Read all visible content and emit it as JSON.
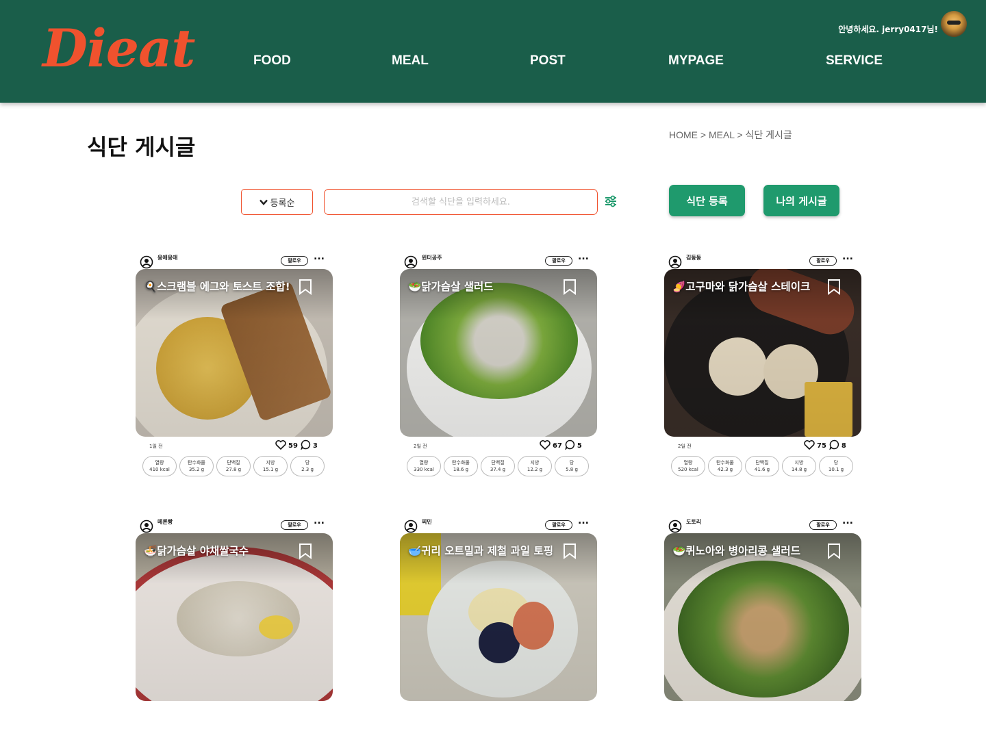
{
  "header": {
    "logo": "Dieat",
    "nav": [
      "FOOD",
      "MEAL",
      "POST",
      "MYPAGE",
      "SERVICE"
    ],
    "greeting": "안녕하세요. jerry0417님!"
  },
  "page": {
    "title": "식단 게시글",
    "breadcrumb": "HOME > MEAL > 식단 게시글"
  },
  "toolbar": {
    "sort_label": "등록순",
    "search_placeholder": "검색할 식단을 입력하세요.",
    "register_label": "식단 등록",
    "my_posts_label": "나의 게시글"
  },
  "nutrient_labels": [
    "열량",
    "탄수화물",
    "단백질",
    "지방",
    "당"
  ],
  "follow_label": "팔로우",
  "more_label": "...",
  "posts": [
    {
      "user": "응애응애",
      "title": "🍳스크램블 에그와 토스트 조합!",
      "time": "1일 전",
      "likes": "59",
      "comments": "3",
      "nutrients": [
        "410 kcal",
        "35.2 g",
        "27.8 g",
        "15.1 g",
        "2.3 g"
      ]
    },
    {
      "user": "윈터공주",
      "title": "🥗닭가슴살 샐러드",
      "time": "2일 전",
      "likes": "67",
      "comments": "5",
      "nutrients": [
        "330 kcal",
        "18.6 g",
        "37.4 g",
        "12.2 g",
        "5.8 g"
      ]
    },
    {
      "user": "김동동",
      "title": "🍠고구마와 닭가슴살 스테이크",
      "time": "2일 전",
      "likes": "75",
      "comments": "8",
      "nutrients": [
        "520 kcal",
        "42.3 g",
        "41.6 g",
        "14.8 g",
        "10.1 g"
      ]
    },
    {
      "user": "메론빵",
      "title": "🍜닭가슴살 야채쌀국수",
      "time": "",
      "likes": "",
      "comments": "",
      "nutrients": []
    },
    {
      "user": "찌민",
      "title": "🥣귀리 오트밀과 제철 과일 토핑",
      "time": "",
      "likes": "",
      "comments": "",
      "nutrients": []
    },
    {
      "user": "도토리",
      "title": "🥗퀴노아와 병아리콩 샐러드",
      "time": "",
      "likes": "",
      "comments": "",
      "nutrients": []
    }
  ]
}
